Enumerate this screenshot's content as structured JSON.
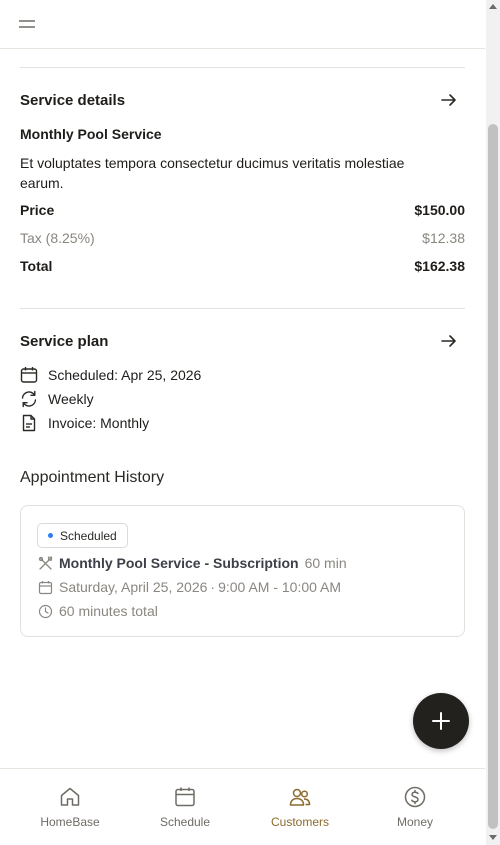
{
  "header": {
    "menu_icon": "hamburger-menu-icon"
  },
  "service_details": {
    "title": "Service details",
    "name": "Monthly Pool Service",
    "description": "Et voluptates tempora consectetur ducimus veritatis molestiae earum.",
    "price_label": "Price",
    "price_value": "$150.00",
    "tax_label": "Tax (8.25%)",
    "tax_value": "$12.38",
    "total_label": "Total",
    "total_value": "$162.38"
  },
  "service_plan": {
    "title": "Service plan",
    "scheduled": "Scheduled: Apr 25, 2026",
    "frequency": "Weekly",
    "invoice": "Invoice: Monthly"
  },
  "appointment_history": {
    "title": "Appointment History",
    "items": [
      {
        "status": "Scheduled",
        "status_color": "#2f7cf6",
        "service": "Monthly Pool Service - Subscription",
        "duration": "60 min",
        "date": "Saturday, April 25, 2026",
        "separator": "·",
        "time": "9:00 AM - 10:00 AM",
        "total": "60 minutes total"
      }
    ]
  },
  "fab": {
    "icon": "plus-icon"
  },
  "bottom_nav": {
    "items": [
      {
        "label": "HomeBase",
        "icon": "home-icon"
      },
      {
        "label": "Schedule",
        "icon": "calendar-icon"
      },
      {
        "label": "Customers",
        "icon": "users-icon",
        "active": true
      },
      {
        "label": "Money",
        "icon": "dollar-circle-icon"
      }
    ],
    "active_color": "#8c6a2b"
  }
}
